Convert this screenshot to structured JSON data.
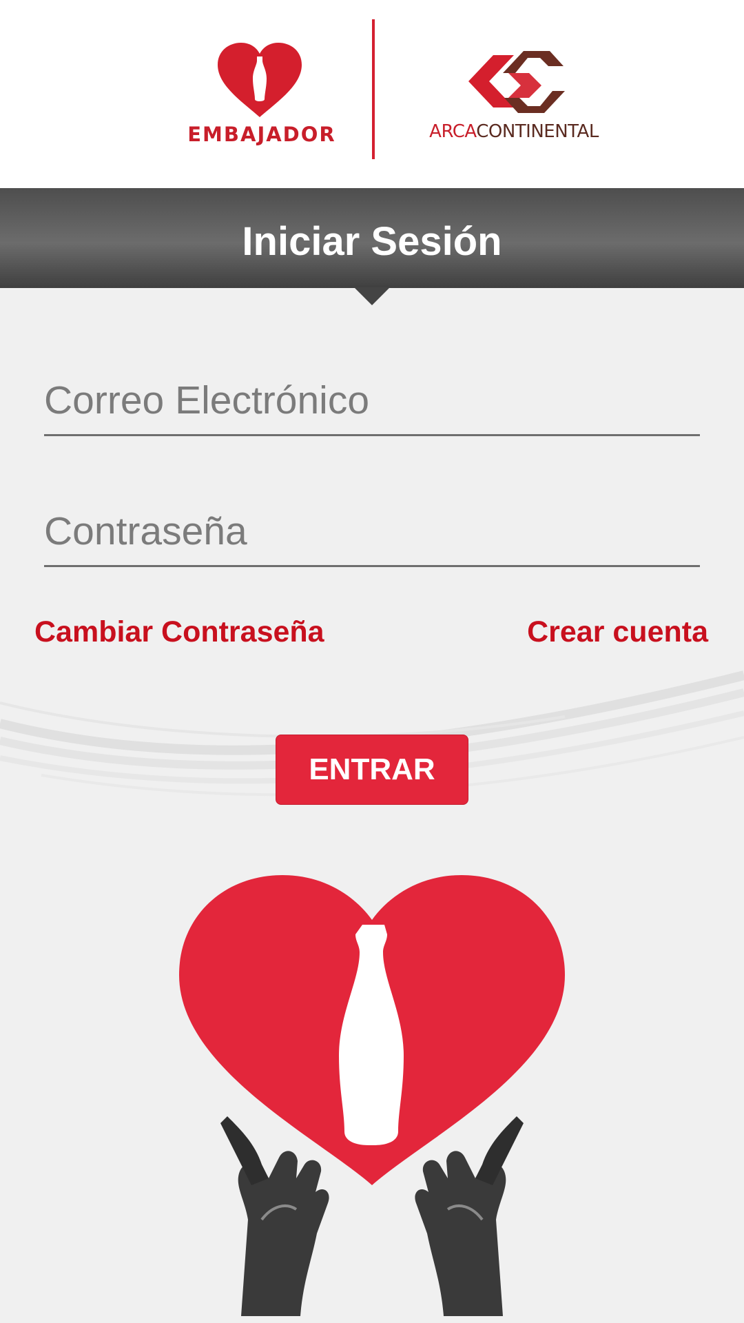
{
  "header": {
    "brand_left": "EMBAJADOR",
    "brand_right_part1": "ARCA",
    "brand_right_part2": "CONTINENTAL"
  },
  "title": "Iniciar Sesión",
  "form": {
    "email_placeholder": "Correo Electrónico",
    "email_value": "",
    "password_placeholder": "Contraseña",
    "password_value": ""
  },
  "links": {
    "change_password": "Cambiar Contraseña",
    "create_account": "Crear cuenta"
  },
  "submit_label": "ENTRAR",
  "icons": {
    "embajador_logo": "heart-bottle-icon",
    "arca_logo": "arca-continental-mark-icon",
    "hero": "heart-bottle-hands-illustration"
  },
  "colors": {
    "brand_red": "#e3263b",
    "link_red": "#c8101e",
    "arca_brown": "#5a2a20",
    "title_band": "#5e5e5e",
    "background": "#f0f0f0"
  }
}
